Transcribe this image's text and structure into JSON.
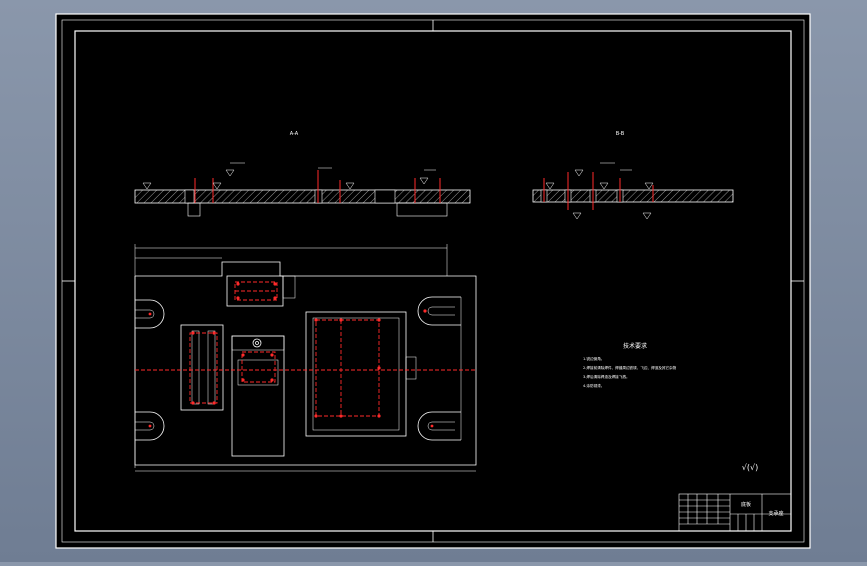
{
  "views": {
    "section_left_label": "A-A",
    "section_right_label": "B-B"
  },
  "tech_requirements": {
    "title": "技术要求",
    "lines": [
      "1.锐边倒角。",
      "2.焊接前清除焊件、焊缝周边铁锈、飞边、焊渣及其它杂物",
      "3.焊后清除焊渣及焊接飞溅。",
      "4.涂防锈漆。"
    ]
  },
  "surface_symbol": "√(√)",
  "title_block": {
    "part_name": "底板",
    "drawing_no": "支承座"
  },
  "colors": {
    "background": "#000000",
    "frame": "#ffffff",
    "centerline": "#ff2a2a",
    "hatch": "#ffffff"
  }
}
